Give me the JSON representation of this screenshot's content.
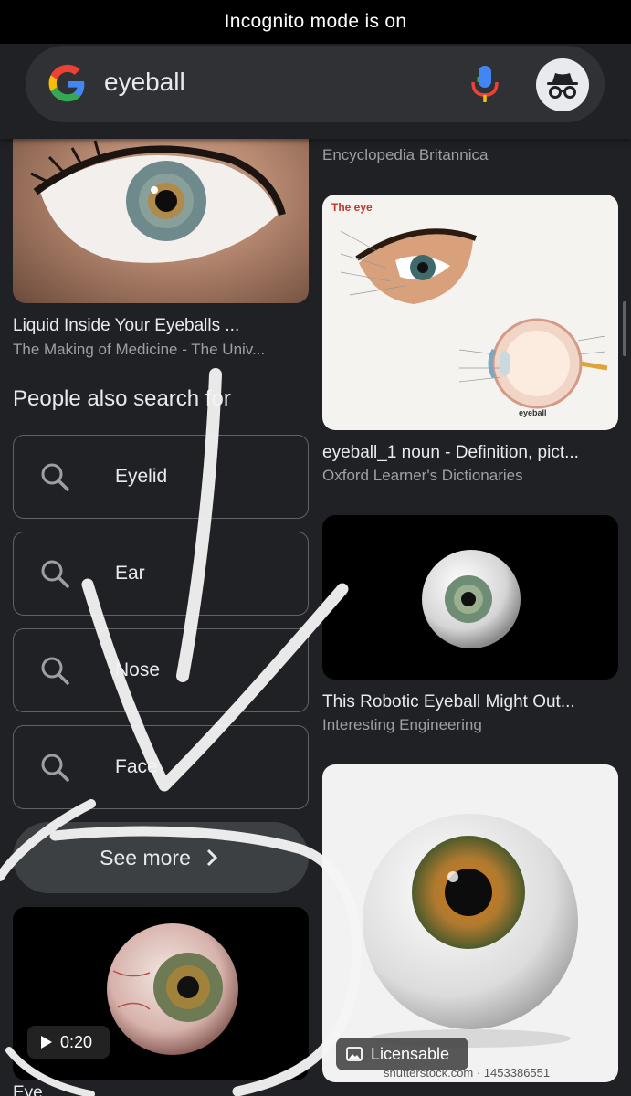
{
  "status_bar": {
    "text": "Incognito mode is on"
  },
  "search": {
    "query": "eyeball"
  },
  "results": {
    "left_top": {
      "title": "Liquid Inside Your Eyeballs ...",
      "source": "The Making of Medicine - The Univ..."
    },
    "right_top": {
      "source": "Encyclopedia Britannica"
    },
    "right_diagram": {
      "title": "eyeball_1 noun - Definition, pict...",
      "source": "Oxford Learner's Dictionaries",
      "diagram_title": "The eye",
      "diagram_caption": "eyeball"
    },
    "right_robot": {
      "title": "This Robotic Eyeball Might Out...",
      "source": "Interesting Engineering"
    },
    "right_bottom": {
      "badge": "Licensable",
      "watermark": "shutterstock.com · 1453386551"
    },
    "left_video": {
      "duration": "0:20",
      "title": "Eye"
    }
  },
  "people_also_search": {
    "heading": "People also search for",
    "items": [
      {
        "label": "Eyelid"
      },
      {
        "label": "Ear"
      },
      {
        "label": "Nose"
      },
      {
        "label": "Face"
      }
    ],
    "see_more": "See more"
  },
  "icons": {
    "google": "google-g-icon",
    "mic": "mic-icon",
    "incognito": "incognito-icon",
    "search": "search-icon",
    "chevron": "chevron-right-icon",
    "play": "play-icon",
    "image": "image-icon"
  },
  "colors": {
    "background": "#202124",
    "surface": "#303134",
    "text": "#e8eaed",
    "muted": "#9aa0a6"
  }
}
